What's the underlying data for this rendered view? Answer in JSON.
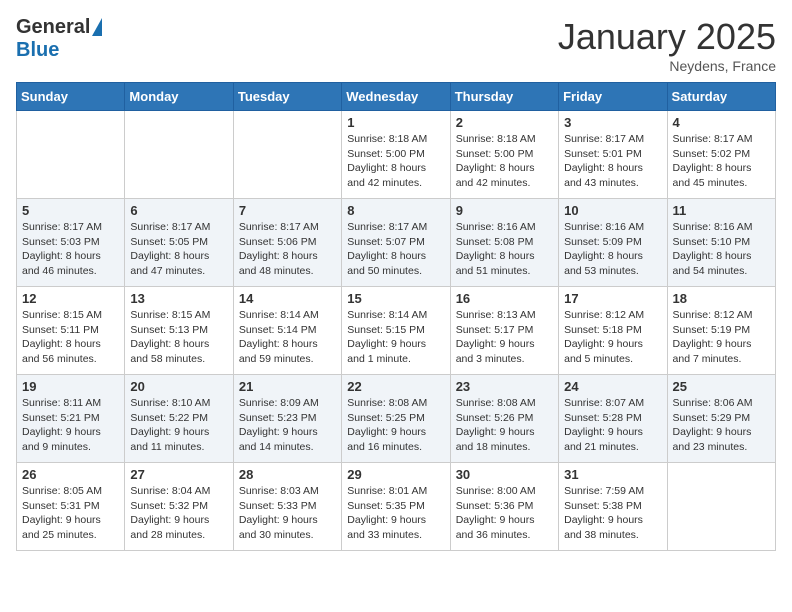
{
  "header": {
    "logo_general": "General",
    "logo_blue": "Blue",
    "month": "January 2025",
    "location": "Neydens, France"
  },
  "weekdays": [
    "Sunday",
    "Monday",
    "Tuesday",
    "Wednesday",
    "Thursday",
    "Friday",
    "Saturday"
  ],
  "weeks": [
    [
      {
        "day": "",
        "info": ""
      },
      {
        "day": "",
        "info": ""
      },
      {
        "day": "",
        "info": ""
      },
      {
        "day": "1",
        "info": "Sunrise: 8:18 AM\nSunset: 5:00 PM\nDaylight: 8 hours and 42 minutes."
      },
      {
        "day": "2",
        "info": "Sunrise: 8:18 AM\nSunset: 5:00 PM\nDaylight: 8 hours and 42 minutes."
      },
      {
        "day": "3",
        "info": "Sunrise: 8:17 AM\nSunset: 5:01 PM\nDaylight: 8 hours and 43 minutes."
      },
      {
        "day": "4",
        "info": "Sunrise: 8:17 AM\nSunset: 5:02 PM\nDaylight: 8 hours and 45 minutes."
      }
    ],
    [
      {
        "day": "5",
        "info": "Sunrise: 8:17 AM\nSunset: 5:03 PM\nDaylight: 8 hours and 46 minutes."
      },
      {
        "day": "6",
        "info": "Sunrise: 8:17 AM\nSunset: 5:05 PM\nDaylight: 8 hours and 47 minutes."
      },
      {
        "day": "7",
        "info": "Sunrise: 8:17 AM\nSunset: 5:06 PM\nDaylight: 8 hours and 48 minutes."
      },
      {
        "day": "8",
        "info": "Sunrise: 8:17 AM\nSunset: 5:07 PM\nDaylight: 8 hours and 50 minutes."
      },
      {
        "day": "9",
        "info": "Sunrise: 8:16 AM\nSunset: 5:08 PM\nDaylight: 8 hours and 51 minutes."
      },
      {
        "day": "10",
        "info": "Sunrise: 8:16 AM\nSunset: 5:09 PM\nDaylight: 8 hours and 53 minutes."
      },
      {
        "day": "11",
        "info": "Sunrise: 8:16 AM\nSunset: 5:10 PM\nDaylight: 8 hours and 54 minutes."
      }
    ],
    [
      {
        "day": "12",
        "info": "Sunrise: 8:15 AM\nSunset: 5:11 PM\nDaylight: 8 hours and 56 minutes."
      },
      {
        "day": "13",
        "info": "Sunrise: 8:15 AM\nSunset: 5:13 PM\nDaylight: 8 hours and 58 minutes."
      },
      {
        "day": "14",
        "info": "Sunrise: 8:14 AM\nSunset: 5:14 PM\nDaylight: 8 hours and 59 minutes."
      },
      {
        "day": "15",
        "info": "Sunrise: 8:14 AM\nSunset: 5:15 PM\nDaylight: 9 hours and 1 minute."
      },
      {
        "day": "16",
        "info": "Sunrise: 8:13 AM\nSunset: 5:17 PM\nDaylight: 9 hours and 3 minutes."
      },
      {
        "day": "17",
        "info": "Sunrise: 8:12 AM\nSunset: 5:18 PM\nDaylight: 9 hours and 5 minutes."
      },
      {
        "day": "18",
        "info": "Sunrise: 8:12 AM\nSunset: 5:19 PM\nDaylight: 9 hours and 7 minutes."
      }
    ],
    [
      {
        "day": "19",
        "info": "Sunrise: 8:11 AM\nSunset: 5:21 PM\nDaylight: 9 hours and 9 minutes."
      },
      {
        "day": "20",
        "info": "Sunrise: 8:10 AM\nSunset: 5:22 PM\nDaylight: 9 hours and 11 minutes."
      },
      {
        "day": "21",
        "info": "Sunrise: 8:09 AM\nSunset: 5:23 PM\nDaylight: 9 hours and 14 minutes."
      },
      {
        "day": "22",
        "info": "Sunrise: 8:08 AM\nSunset: 5:25 PM\nDaylight: 9 hours and 16 minutes."
      },
      {
        "day": "23",
        "info": "Sunrise: 8:08 AM\nSunset: 5:26 PM\nDaylight: 9 hours and 18 minutes."
      },
      {
        "day": "24",
        "info": "Sunrise: 8:07 AM\nSunset: 5:28 PM\nDaylight: 9 hours and 21 minutes."
      },
      {
        "day": "25",
        "info": "Sunrise: 8:06 AM\nSunset: 5:29 PM\nDaylight: 9 hours and 23 minutes."
      }
    ],
    [
      {
        "day": "26",
        "info": "Sunrise: 8:05 AM\nSunset: 5:31 PM\nDaylight: 9 hours and 25 minutes."
      },
      {
        "day": "27",
        "info": "Sunrise: 8:04 AM\nSunset: 5:32 PM\nDaylight: 9 hours and 28 minutes."
      },
      {
        "day": "28",
        "info": "Sunrise: 8:03 AM\nSunset: 5:33 PM\nDaylight: 9 hours and 30 minutes."
      },
      {
        "day": "29",
        "info": "Sunrise: 8:01 AM\nSunset: 5:35 PM\nDaylight: 9 hours and 33 minutes."
      },
      {
        "day": "30",
        "info": "Sunrise: 8:00 AM\nSunset: 5:36 PM\nDaylight: 9 hours and 36 minutes."
      },
      {
        "day": "31",
        "info": "Sunrise: 7:59 AM\nSunset: 5:38 PM\nDaylight: 9 hours and 38 minutes."
      },
      {
        "day": "",
        "info": ""
      }
    ]
  ]
}
